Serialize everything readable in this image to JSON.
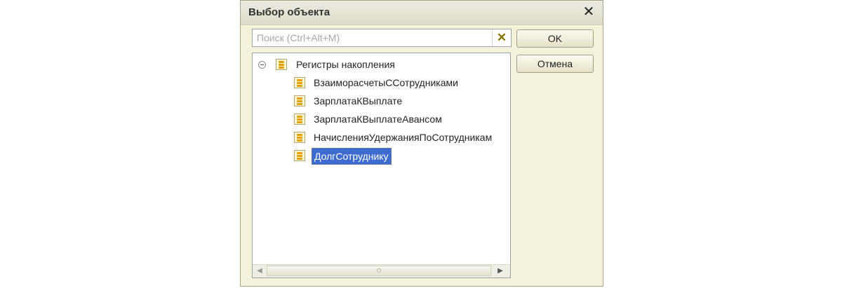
{
  "window": {
    "title": "Выбор объекта"
  },
  "search": {
    "placeholder": "Поиск (Ctrl+Alt+M)",
    "value": ""
  },
  "buttons": {
    "ok": "OK",
    "cancel": "Отмена"
  },
  "tree": {
    "root": {
      "label": "Регистры накопления",
      "expanded": true,
      "icon": "register-icon"
    },
    "items": [
      {
        "label": "ВзаиморасчетыССотрудниками",
        "icon": "register-icon",
        "selected": false
      },
      {
        "label": "ЗарплатаКВыплате",
        "icon": "register-icon",
        "selected": false
      },
      {
        "label": "ЗарплатаКВыплатеАвансом",
        "icon": "register-icon",
        "selected": false
      },
      {
        "label": "НачисленияУдержанияПоСотрудникам",
        "icon": "register-icon",
        "selected": false
      },
      {
        "label": "ДолгСотруднику",
        "icon": "register-icon",
        "selected": true
      }
    ]
  },
  "colors": {
    "selection": "#3d6bd0",
    "dialog_bg": "#f5f2dc",
    "icon_accent": "#e5a000"
  }
}
